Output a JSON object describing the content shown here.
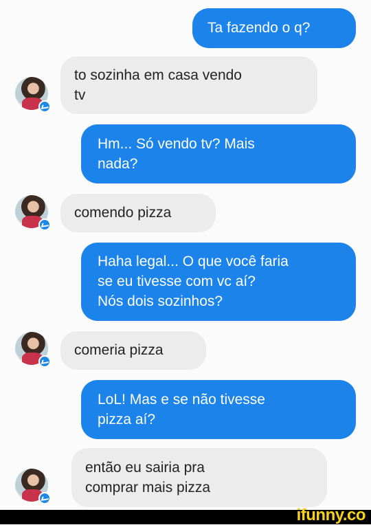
{
  "messages": [
    {
      "direction": "out",
      "text": "Ta fazendo o q?"
    },
    {
      "direction": "in",
      "text": "to sozinha em casa vendo\ntv"
    },
    {
      "direction": "out",
      "text": "Hm... Só vendo tv? Mais\nnada?"
    },
    {
      "direction": "in",
      "text": "comendo pizza"
    },
    {
      "direction": "out",
      "text": "Haha legal... O que você faria\nse eu tivesse com vc aí?\nNós dois sozinhos?"
    },
    {
      "direction": "in",
      "text": "comeria pizza"
    },
    {
      "direction": "out",
      "text": "LoL! Mas e se não tivesse\npizza aí?"
    },
    {
      "direction": "in",
      "text": "então eu sairia pra\ncomprar mais pizza"
    }
  ],
  "watermark": "ifunny.co",
  "colors": {
    "outgoing": "#1b83ea",
    "incoming": "#ececec",
    "brand": "#f6d21b"
  }
}
